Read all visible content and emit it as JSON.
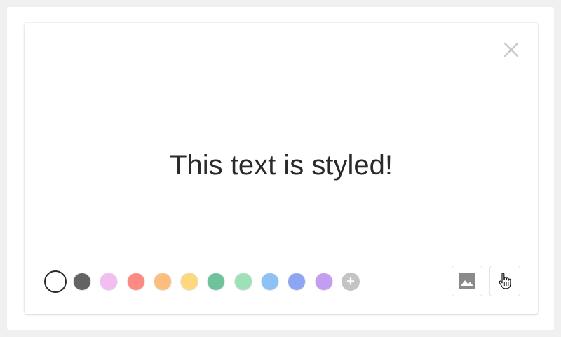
{
  "card": {
    "text": "This text is styled!"
  },
  "palette": {
    "swatches": [
      {
        "name": "white",
        "color": "#ffffff",
        "selected": true
      },
      {
        "name": "dark-gray",
        "color": "#636363"
      },
      {
        "name": "pink",
        "color": "#f3bdf1"
      },
      {
        "name": "red",
        "color": "#fc8a82"
      },
      {
        "name": "orange",
        "color": "#fdbd7e"
      },
      {
        "name": "yellow",
        "color": "#fdd87e"
      },
      {
        "name": "green",
        "color": "#6ec39b"
      },
      {
        "name": "light-green",
        "color": "#9fe1b6"
      },
      {
        "name": "light-blue",
        "color": "#8ec2f4"
      },
      {
        "name": "blue",
        "color": "#8da5f2"
      },
      {
        "name": "purple",
        "color": "#c39df0"
      }
    ],
    "add_symbol": "+"
  },
  "icons": {
    "close": "close-icon",
    "image": "image-icon",
    "gesture": "hand-pointer-icon"
  },
  "colors": {
    "text": "#2a2a2a",
    "close": "#c8c8c8",
    "image_icon": "#8a8a8a",
    "add_swatch": "#c4c4c4"
  }
}
